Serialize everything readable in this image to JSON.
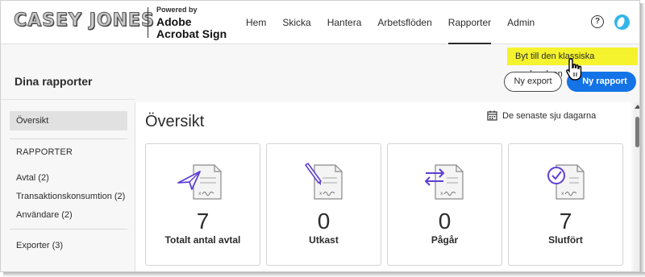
{
  "header": {
    "logo_text": "CASEY JONES",
    "powered_by": "Powered by",
    "brand_line1": "Adobe",
    "brand_line2": "Acrobat Sign",
    "help_glyph": "?",
    "nav": [
      {
        "label": "Hem",
        "active": false
      },
      {
        "label": "Skicka",
        "active": false
      },
      {
        "label": "Hantera",
        "active": false
      },
      {
        "label": "Arbetsflöden",
        "active": false
      },
      {
        "label": "Rapporter",
        "active": true
      },
      {
        "label": "Admin",
        "active": false
      }
    ]
  },
  "page": {
    "title": "Dina rapporter",
    "tooltip": "Byt till den klassiska upplevelsen",
    "new_export_label": "Ny export",
    "new_report_label": "Ny rapport"
  },
  "sidebar": {
    "overview_label": "Översikt",
    "reports_heading": "RAPPORTER",
    "items": [
      {
        "label": "Avtal (2)"
      },
      {
        "label": "Transaktionskonsumtion (2)"
      },
      {
        "label": "Användare (2)"
      }
    ],
    "exports_label": "Exporter (3)"
  },
  "main": {
    "title": "Översikt",
    "date_range": "De senaste sju dagarna",
    "cards": [
      {
        "count": "7",
        "label": "Totalt antal avtal",
        "icon": "send-document-icon"
      },
      {
        "count": "0",
        "label": "Utkast",
        "icon": "draft-document-icon"
      },
      {
        "count": "0",
        "label": "Pågår",
        "icon": "in-progress-document-icon"
      },
      {
        "count": "7",
        "label": "Slutfört",
        "icon": "completed-document-icon"
      }
    ]
  },
  "colors": {
    "accent": "#1473e6",
    "icon_purple": "#6e4ed8",
    "tooltip_bg": "#f4f32d",
    "avatar": "#33b5e8"
  }
}
